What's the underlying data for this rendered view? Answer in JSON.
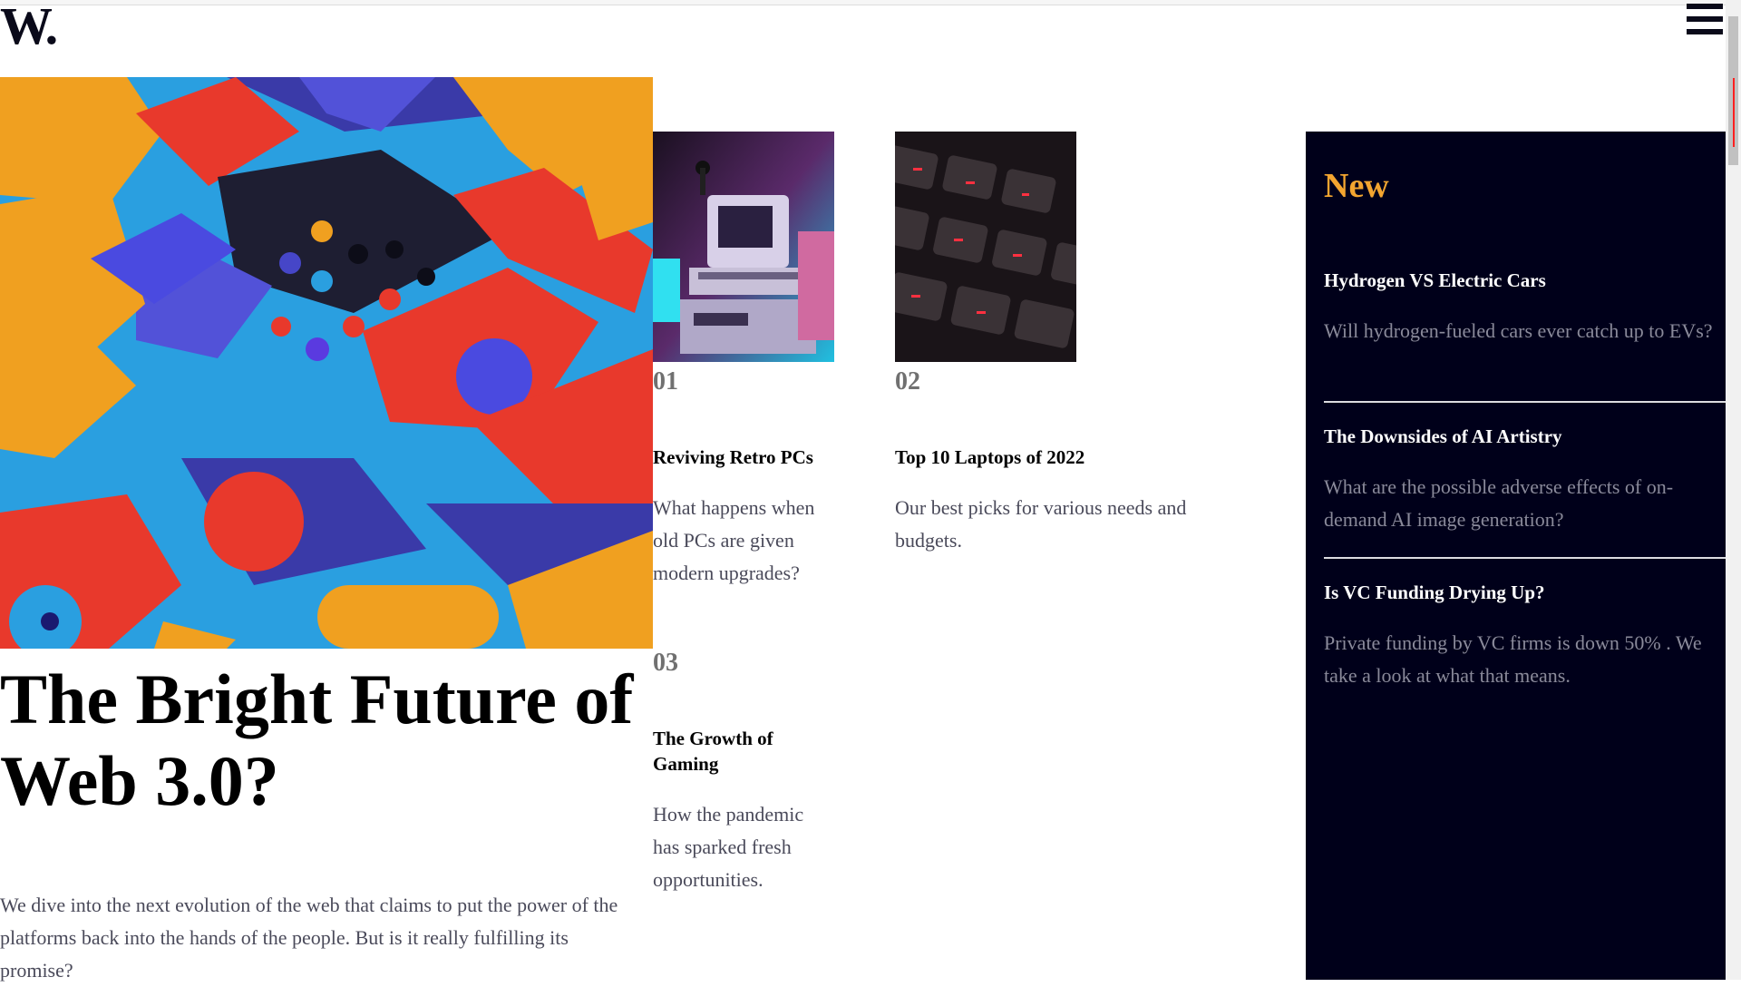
{
  "brand": {
    "logo": "W."
  },
  "header": {
    "menu_icon": "hamburger-icon"
  },
  "hero": {
    "title": "The Bright Future of Web 3.0?",
    "description": "We dive into the next evolution of the web that claims to put the power of the platforms back into the hands of the people. But is it really fulfilling its promise?"
  },
  "articles": [
    {
      "number": "01",
      "title": "Reviving Retro PCs",
      "description": "What happens when old PCs are given modern upgrades?"
    },
    {
      "number": "02",
      "title": "Top 10 Laptops of 2022",
      "description": "Our best picks for various needs and budgets."
    },
    {
      "number": "03",
      "title": "The Growth of Gaming",
      "description": "How the pandemic has sparked fresh opportunities."
    }
  ],
  "sidebar": {
    "heading": "New",
    "items": [
      {
        "title": "Hydrogen VS Electric Cars",
        "description": "Will hydrogen-fueled cars ever catch up to EVs?"
      },
      {
        "title": "The Downsides of AI Artistry",
        "description": "What are the possible adverse effects of on-demand AI image generation?"
      },
      {
        "title": "Is VC Funding Drying Up?",
        "description": "Private funding by VC firms is down 50% . We take a look at what that means."
      }
    ]
  },
  "colors": {
    "accent": "#f3a530",
    "sidebar_bg": "#00001a",
    "text_muted": "#4a4a5a",
    "number_gray": "#707070"
  }
}
